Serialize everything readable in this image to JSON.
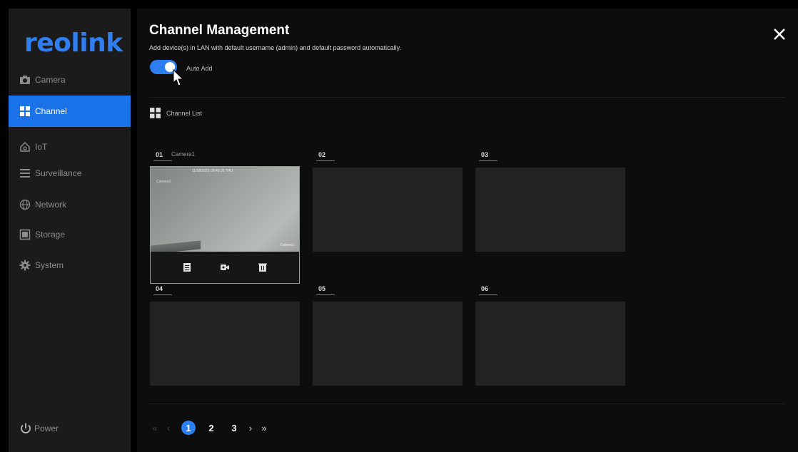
{
  "sidebar": {
    "logo": "reolink",
    "items": [
      {
        "label": "Camera",
        "icon": "camera-icon"
      },
      {
        "label": "Channel",
        "icon": "channel-grid-icon",
        "active": true
      },
      {
        "label": "IoT",
        "icon": "home-icon"
      },
      {
        "label": "Surveillance",
        "icon": "list-icon"
      },
      {
        "label": "Network",
        "icon": "globe-icon"
      },
      {
        "label": "Storage",
        "icon": "storage-icon"
      },
      {
        "label": "System",
        "icon": "gear-icon"
      }
    ],
    "power_label": "Power"
  },
  "header": {
    "title": "Channel Management",
    "subtitle": "Add device(s) in LAN with default username (admin) and default password automatically.",
    "auto_add_label": "Auto Add",
    "auto_add_on": true
  },
  "channel_list": {
    "heading": "Channel List",
    "channels": [
      {
        "number": "01",
        "name": "Camera1",
        "live": true,
        "timestamp": "11/18/2021 09:40:35 THU",
        "cam_text": "Camera1",
        "cam_top_left": "Camera1"
      },
      {
        "number": "02",
        "name": ""
      },
      {
        "number": "03",
        "name": ""
      },
      {
        "number": "04",
        "name": ""
      },
      {
        "number": "05",
        "name": ""
      },
      {
        "number": "06",
        "name": ""
      }
    ]
  },
  "pagination": {
    "first": "«",
    "prev": "‹",
    "pages": [
      "1",
      "2",
      "3"
    ],
    "current": "1",
    "next": "›",
    "last": "»"
  },
  "colors": {
    "accent": "#1a73e8",
    "toggle": "#2b7ff0",
    "sidebar_bg": "#1b1b1b",
    "main_bg": "#0d0d0d",
    "tile_bg": "#232323"
  }
}
